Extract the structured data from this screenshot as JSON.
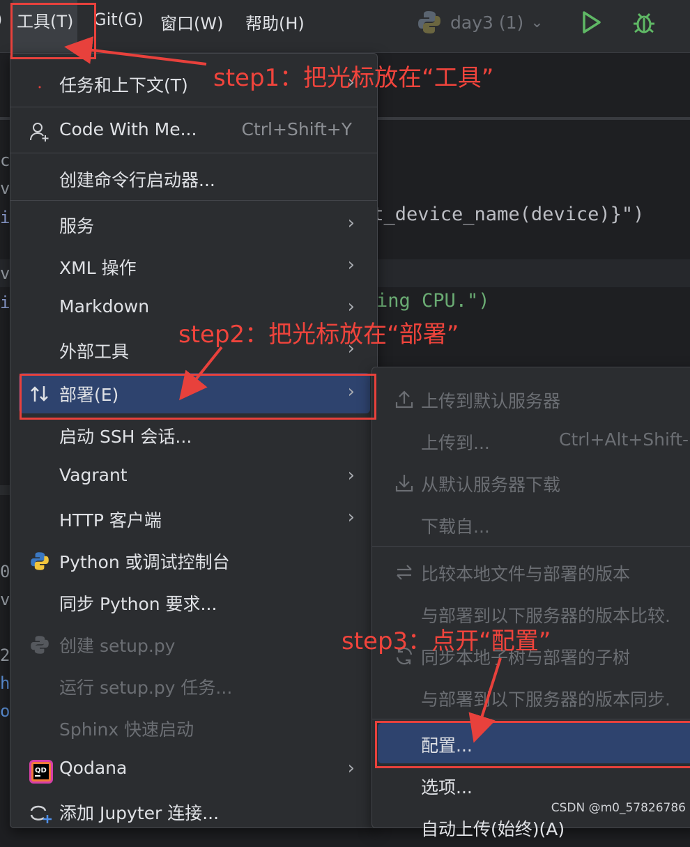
{
  "menubar": {
    "items": [
      {
        "label": "工具(T)"
      },
      {
        "label": "Git(G)"
      },
      {
        "label": "窗口(W)"
      },
      {
        "label": "帮助(H)"
      }
    ],
    "run_config": "day3 (1)"
  },
  "editor": {
    "lines": [
      "et_device_name(device)}\")",
      "ing CPU.\")"
    ]
  },
  "tools_menu": {
    "items": [
      {
        "label": "任务和上下文(T)",
        "arrow": "›"
      },
      {
        "label": "Code With Me...",
        "shortcut": "Ctrl+Shift+Y"
      },
      {
        "label": "创建命令行启动器..."
      },
      {
        "label": "服务",
        "arrow": "›"
      },
      {
        "label": "XML 操作",
        "arrow": "›"
      },
      {
        "label": "Markdown",
        "arrow": "›"
      },
      {
        "label": "外部工具",
        "arrow": "›"
      },
      {
        "label": "部署(E)",
        "arrow": "›"
      },
      {
        "label": "启动 SSH 会话..."
      },
      {
        "label": "Vagrant",
        "arrow": "›"
      },
      {
        "label": "HTTP 客户端",
        "arrow": "›"
      },
      {
        "label": "Python 或调试控制台"
      },
      {
        "label": "同步 Python 要求..."
      },
      {
        "label": "创建 setup.py"
      },
      {
        "label": "运行 setup.py 任务..."
      },
      {
        "label": "Sphinx 快速启动"
      },
      {
        "label": "Qodana",
        "arrow": "›"
      },
      {
        "label": "添加 Jupyter 连接..."
      }
    ]
  },
  "deploy_submenu": {
    "items": [
      {
        "label": "上传到默认服务器"
      },
      {
        "label": "上传到...",
        "shortcut": "Ctrl+Alt+Shift-"
      },
      {
        "label": "从默认服务器下载"
      },
      {
        "label": "下载自..."
      },
      {
        "label": "比较本地文件与部署的版本"
      },
      {
        "label": "与部署到以下服务器的版本比较."
      },
      {
        "label": "同步本地子树与部署的子树"
      },
      {
        "label": "与部署到以下服务器的版本同步."
      },
      {
        "label": "配置..."
      },
      {
        "label": "选项..."
      },
      {
        "label": "自动上传(始终)(A)"
      }
    ]
  },
  "annotations": {
    "step1": "step1：把光标放在“工具”",
    "step2": "step2：把光标放在“部署”",
    "step3": "step3：点开“配置”"
  },
  "watermark": "CSDN @m0_57826786",
  "colors": {
    "accent_red": "#e8413c",
    "highlight": "#2e436e",
    "menu_bg": "#2b2d30"
  }
}
